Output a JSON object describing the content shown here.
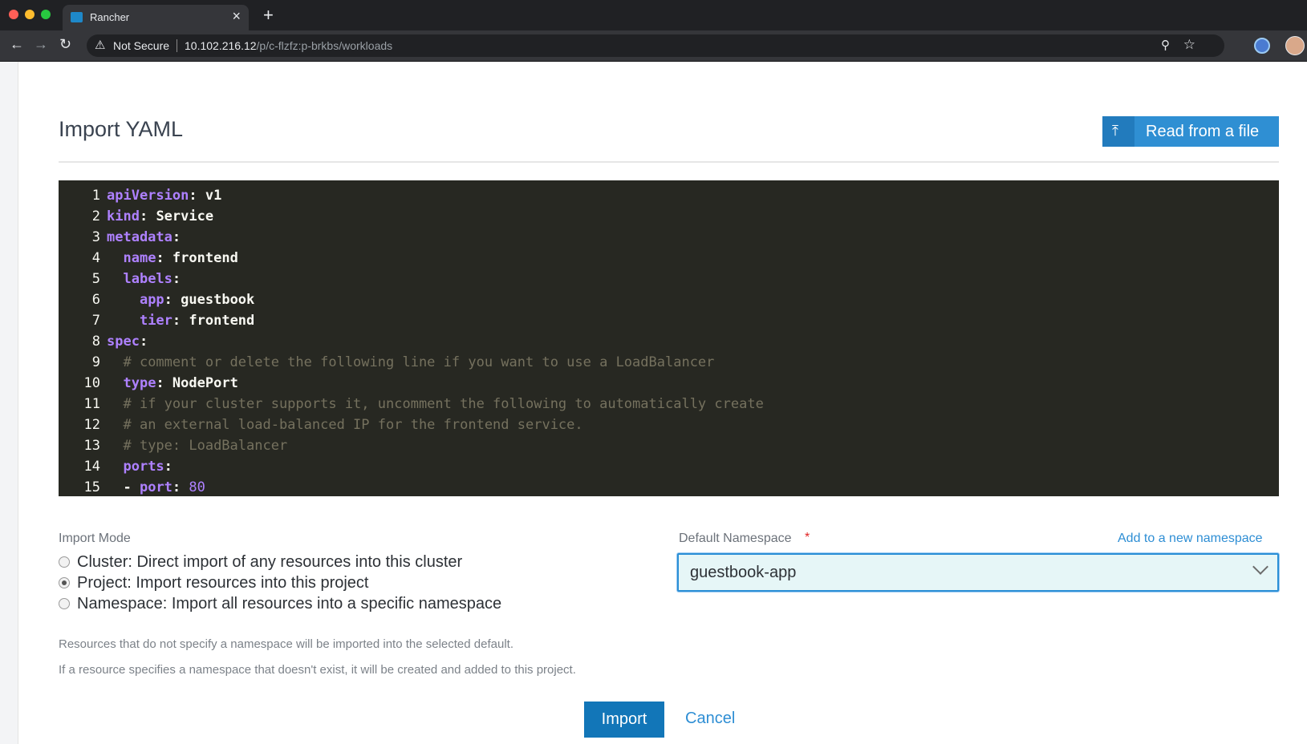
{
  "browser": {
    "tab_title": "Rancher",
    "new_tab": "+",
    "close_tab": "×",
    "security_label": "Not Secure",
    "url_host": "10.102.216.12",
    "url_path": "/p/c-flzfz:p-brkbs/workloads"
  },
  "page": {
    "title": "Import YAML",
    "read_button": "Read from a file"
  },
  "editor": {
    "lines": [
      {
        "n": "1",
        "indent": "",
        "key": "apiVersion",
        "value": " v1"
      },
      {
        "n": "2",
        "indent": "",
        "key": "kind",
        "value": " Service"
      },
      {
        "n": "3",
        "indent": "",
        "key": "metadata",
        "value": ""
      },
      {
        "n": "4",
        "indent": "  ",
        "key": "name",
        "value": " frontend"
      },
      {
        "n": "5",
        "indent": "  ",
        "key": "labels",
        "value": ""
      },
      {
        "n": "6",
        "indent": "    ",
        "key": "app",
        "value": " guestbook"
      },
      {
        "n": "7",
        "indent": "    ",
        "key": "tier",
        "value": " frontend"
      },
      {
        "n": "8",
        "indent": "",
        "key": "spec",
        "value": ""
      },
      {
        "n": "9",
        "indent": "  ",
        "comment": "# comment or delete the following line if you want to use a LoadBalancer"
      },
      {
        "n": "10",
        "indent": "  ",
        "key": "type",
        "value": " NodePort"
      },
      {
        "n": "11",
        "indent": "  ",
        "comment": "# if your cluster supports it, uncomment the following to automatically create"
      },
      {
        "n": "12",
        "indent": "  ",
        "comment": "# an external load-balanced IP for the frontend service."
      },
      {
        "n": "13",
        "indent": "  ",
        "comment": "# type: LoadBalancer"
      },
      {
        "n": "14",
        "indent": "  ",
        "key": "ports",
        "value": ""
      },
      {
        "n": "15",
        "indent": "  ",
        "dash": "- ",
        "key": "port",
        "number": " 80"
      }
    ]
  },
  "import_mode": {
    "label": "Import Mode",
    "options": [
      {
        "text": "Cluster: Direct import of any resources into this cluster",
        "checked": false
      },
      {
        "text": "Project: Import resources into this project",
        "checked": true
      },
      {
        "text": "Namespace: Import all resources into a specific namespace",
        "checked": false
      }
    ]
  },
  "namespace": {
    "label": "Default Namespace",
    "required_mark": "*",
    "add_link": "Add to a new namespace",
    "selected": "guestbook-app"
  },
  "help": [
    "Resources that do not specify a namespace will be imported into the selected default.",
    "If a resource specifies a namespace that doesn't exist, it will be created and added to this project."
  ],
  "actions": {
    "import": "Import",
    "cancel": "Cancel"
  }
}
